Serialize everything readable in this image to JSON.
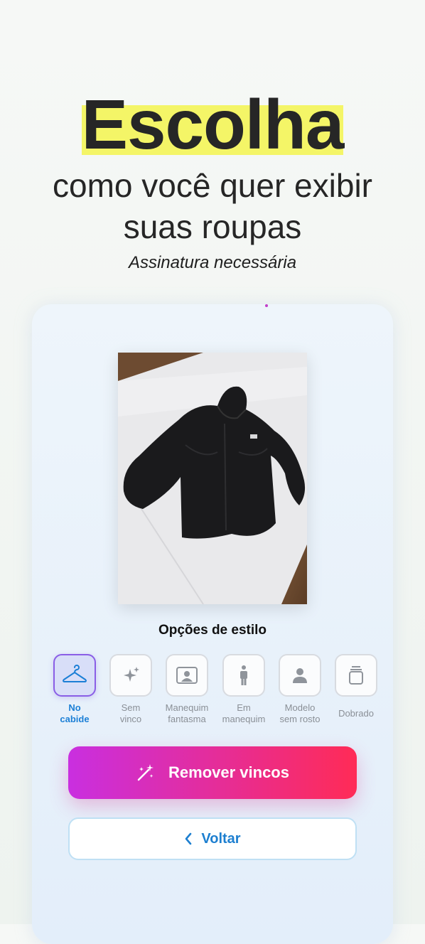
{
  "header": {
    "title": "Escolha",
    "subtitle_line1": "como você quer exibir",
    "subtitle_line2": "suas roupas",
    "note": "Assinatura necessária",
    "highlight_color": "#f4f567"
  },
  "preview": {
    "image": "black-hooded-jacket-photo"
  },
  "style_options": {
    "title": "Opções de estilo",
    "items": [
      {
        "icon": "hanger-icon",
        "label": "No\ncabide",
        "selected": true
      },
      {
        "icon": "sparkles-icon",
        "label": "Sem\nvinco",
        "selected": false
      },
      {
        "icon": "portrait-frame-icon",
        "label": "Manequim\nfantasma",
        "selected": false
      },
      {
        "icon": "mannequin-icon",
        "label": "Em\nmanequim",
        "selected": false
      },
      {
        "icon": "person-icon",
        "label": "Modelo\nsem rosto",
        "selected": false
      },
      {
        "icon": "folded-stack-icon",
        "label": "Dobrado",
        "selected": false
      }
    ]
  },
  "actions": {
    "primary_label": "Remover vincos",
    "primary_icon": "magic-wand-icon",
    "secondary_label": "Voltar",
    "secondary_icon": "chevron-left-icon",
    "primary_gradient": [
      "#c92fe0",
      "#ff2b56"
    ],
    "accent": "#1d7fd0"
  }
}
